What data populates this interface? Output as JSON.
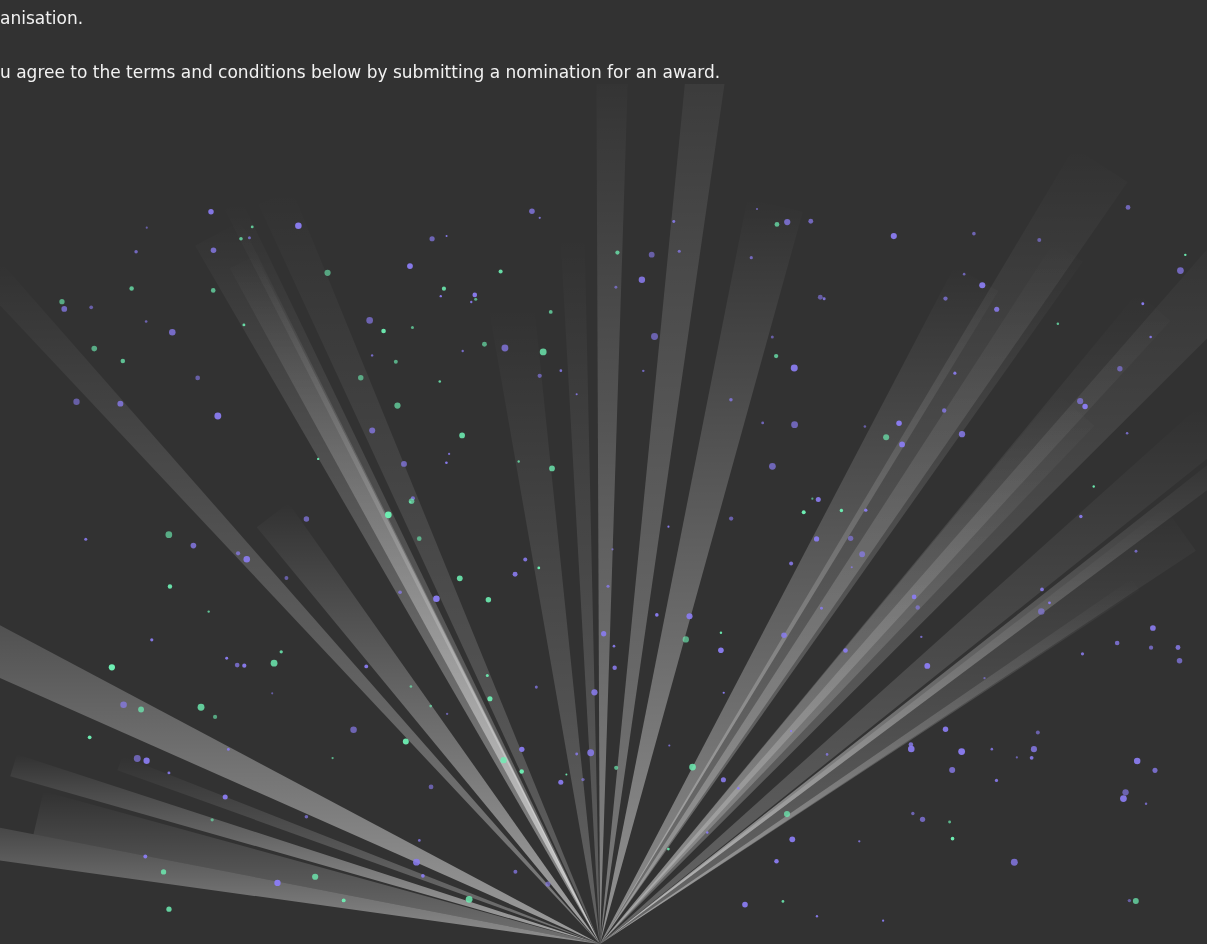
{
  "paragraphs": [
    "anisation.",
    "u agree to the terms and conditions below by submitting a nomination for an award."
  ]
}
